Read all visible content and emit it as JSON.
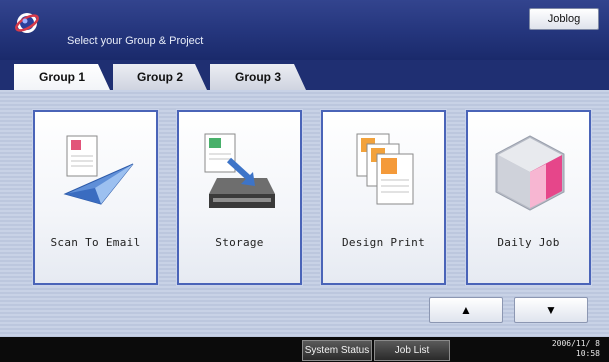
{
  "header": {
    "title": "Select your Group & Project",
    "joblog_label": "Joblog",
    "logo_icon": "globe-logo-icon"
  },
  "tabs": [
    {
      "label": "Group 1",
      "active": true
    },
    {
      "label": "Group 2",
      "active": false
    },
    {
      "label": "Group 3",
      "active": false
    }
  ],
  "tiles": [
    {
      "label": "Scan To Email",
      "icon": "paper-plane-document-icon"
    },
    {
      "label": "Storage",
      "icon": "storage-drive-icon"
    },
    {
      "label": "Design Print",
      "icon": "stacked-documents-icon"
    },
    {
      "label": "Daily Job",
      "icon": "cube-icon"
    }
  ],
  "scroll": {
    "up_label": "▲",
    "down_label": "▼"
  },
  "statusbar": {
    "system_status_label": "System Status",
    "job_list_label": "Job List",
    "date": "2006/11/ 8",
    "time": "10:58"
  },
  "colors": {
    "header": "#24357c",
    "tile_border": "#4a64b8",
    "content_bg": "#c8d2e6"
  }
}
